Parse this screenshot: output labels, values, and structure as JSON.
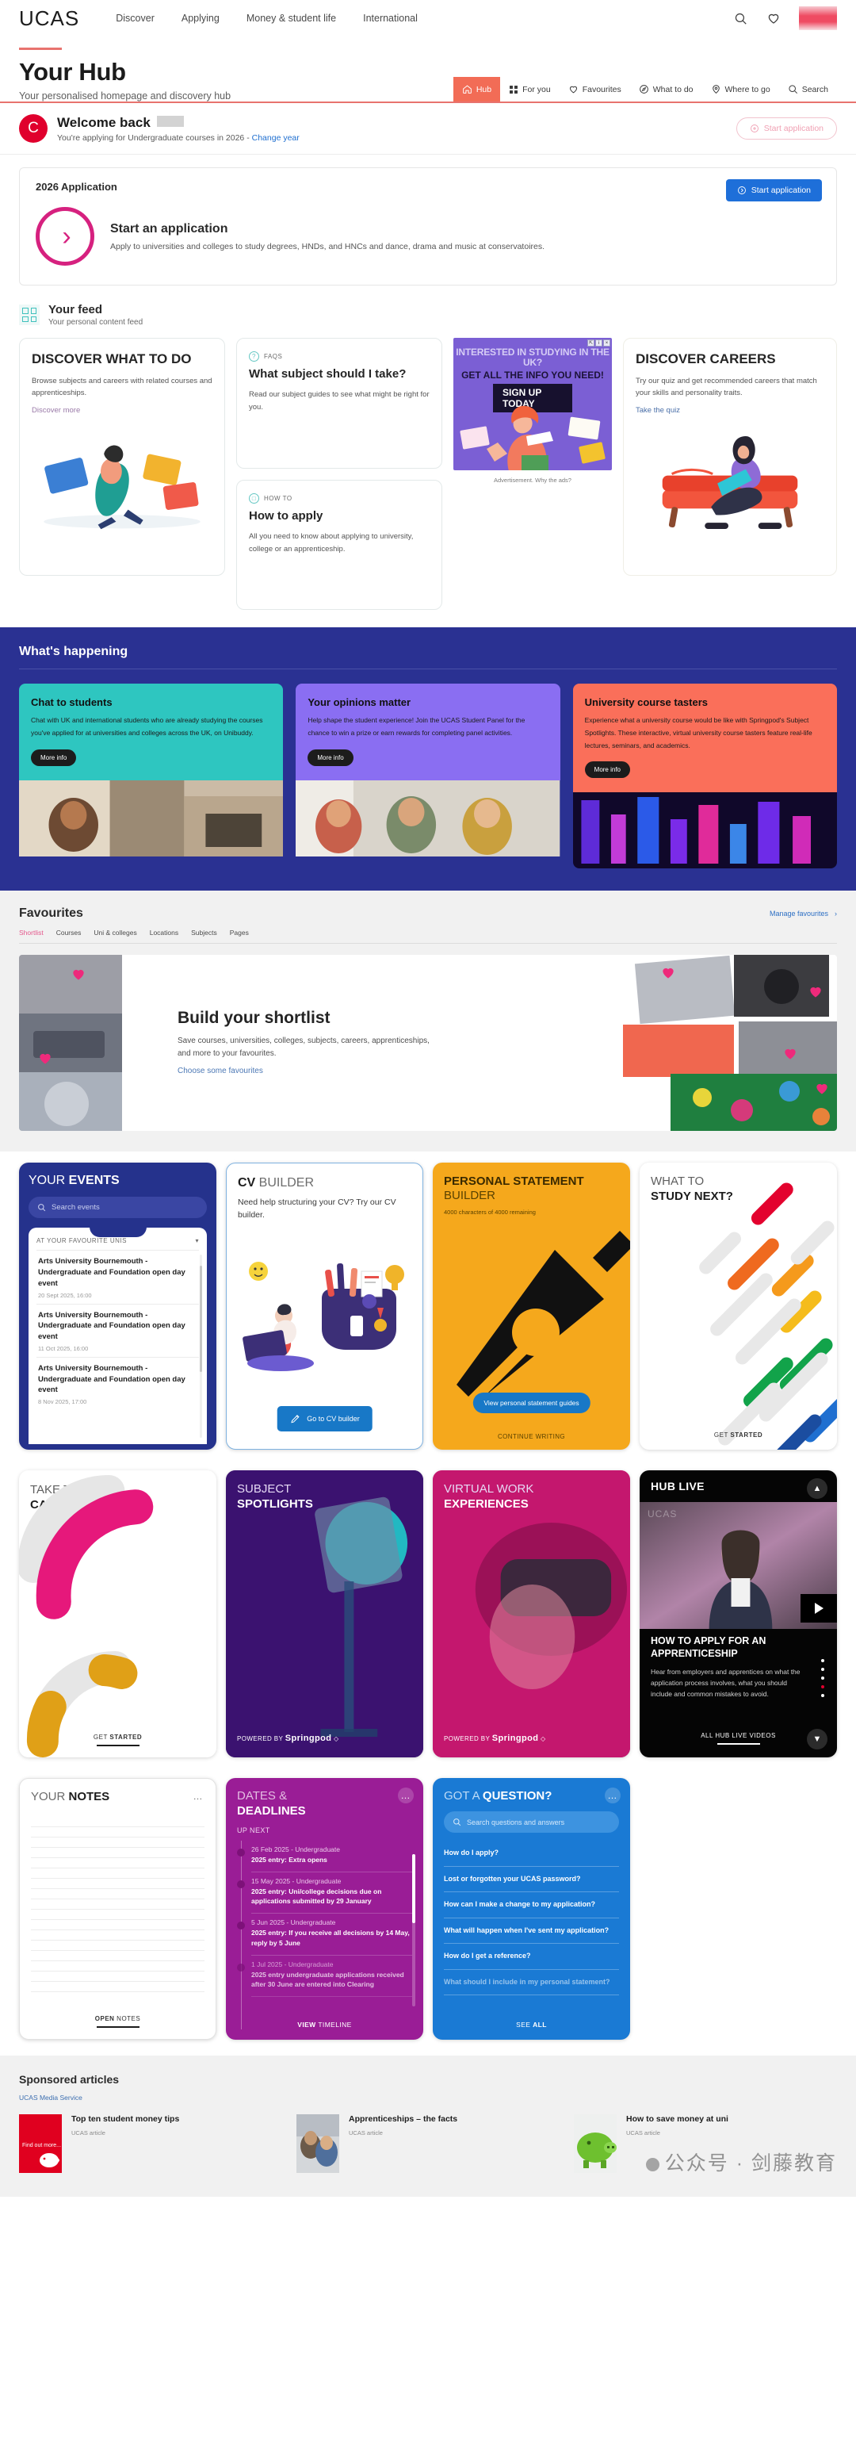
{
  "topnav": {
    "logo": "UCAS",
    "links": [
      "Discover",
      "Applying",
      "Money & student life",
      "International"
    ],
    "icons": {
      "search": "search-icon",
      "favourites": "heart-icon"
    }
  },
  "hero": {
    "title": "Your Hub",
    "subtitle": "Your personalised homepage and discovery hub",
    "tabs": [
      {
        "label": "Hub",
        "icon": "home-icon",
        "active": true
      },
      {
        "label": "For you",
        "icon": "grid-icon",
        "active": false
      },
      {
        "label": "Favourites",
        "icon": "heart-icon",
        "active": false
      },
      {
        "label": "What to do",
        "icon": "compass-icon",
        "active": false
      },
      {
        "label": "Where to go",
        "icon": "pin-icon",
        "active": false
      },
      {
        "label": "Search",
        "icon": "search-icon",
        "active": false
      }
    ]
  },
  "welcome": {
    "avatar_initial": "C",
    "greeting": "Welcome back",
    "name_redacted": true,
    "status_prefix": "You're applying for Undergraduate courses in 2026 -",
    "change_year_link": "Change year",
    "start_application_label": "Start application"
  },
  "application": {
    "card_title": "2026 Application",
    "start_button": "Start application",
    "heading": "Start an application",
    "description": "Apply to universities and colleges to study degrees, HNDs, and HNCs and dance, drama and music at conservatoires."
  },
  "feed": {
    "heading": "Your feed",
    "subheading": "Your personal content feed",
    "cards": [
      {
        "title": "DISCOVER WHAT TO DO",
        "body": "Browse subjects and careers with related courses and apprenticeships.",
        "link": "Discover more"
      },
      {
        "eyebrow": "FAQS",
        "title": "What subject should I take?",
        "body": "Read our subject guides to see what might be right for you."
      },
      {
        "eyebrow": "HOW TO",
        "title": "How to apply",
        "body": "All you need to know about applying to university, college or an apprenticeship."
      },
      {
        "title": "DISCOVER CAREERS",
        "body": "Try our quiz and get recommended careers that match your skills and personality traits.",
        "link": "Take the quiz"
      }
    ],
    "ad": {
      "line1": "INTERESTED IN STUDYING IN THE UK?",
      "line2": "GET ALL THE INFO YOU NEED!",
      "cta": "SIGN UP TODAY",
      "note": "Advertisement.",
      "note_link": "Why the ads?"
    }
  },
  "happening": {
    "heading": "What's happening",
    "cards": [
      {
        "title": "Chat to students",
        "body": "Chat with UK and international students who are already studying the courses you've applied for at universities and colleges across the UK, on Unibuddy.",
        "button": "More info",
        "color": "#2ec6c0"
      },
      {
        "title": "Your opinions matter",
        "body": "Help shape the student experience! Join the UCAS Student Panel for the chance to win a prize or earn rewards for completing panel activities.",
        "button": "More info",
        "color": "#8a6ef2"
      },
      {
        "title": "University course tasters",
        "body": "Experience what a university course would be like with Springpod's Subject Spotlights. These interactive, virtual university course tasters feature real-life lectures, seminars, and academics.",
        "button": "More info",
        "color": "#fa6f5a"
      }
    ]
  },
  "favourites": {
    "heading": "Favourites",
    "manage_link": "Manage favourites",
    "tabs": [
      "Shortlist",
      "Courses",
      "Uni & colleges",
      "Locations",
      "Subjects",
      "Pages"
    ],
    "active_tab": "Shortlist",
    "shortlist": {
      "title": "Build your shortlist",
      "body": "Save courses, universities, colleges, subjects, careers, apprenticeships, and more to your favourites.",
      "link": "Choose some favourites"
    }
  },
  "tiles": {
    "events": {
      "title_light": "YOUR ",
      "title_bold": "EVENTS",
      "search_placeholder": "Search events",
      "list_header": "AT YOUR FAVOURITE UNIS",
      "items": [
        {
          "name": "Arts University Bournemouth - Undergraduate and Foundation open day event",
          "date": "20 Sept 2025, 16:00"
        },
        {
          "name": "Arts University Bournemouth - Undergraduate and Foundation open day event",
          "date": "11 Oct 2025, 16:00"
        },
        {
          "name": "Arts University Bournemouth - Undergraduate and Foundation open day event",
          "date": "8 Nov 2025, 17:00"
        }
      ]
    },
    "cv": {
      "title_bold": "CV ",
      "title_light": "BUILDER",
      "body": "Need help structuring your CV? Try our CV builder.",
      "button": "Go to CV builder"
    },
    "personal_statement": {
      "title_bold": "PERSONAL STATEMENT ",
      "title_light": "BUILDER",
      "counter": "4000 characters of 4000 remaining",
      "button": "View personal statement guides",
      "footer": "CONTINUE WRITING"
    },
    "study_next": {
      "title_light": "WHAT TO",
      "title_bold": "STUDY NEXT?",
      "footer_light": "GET ",
      "footer_bold": "STARTED"
    },
    "careers_quiz": {
      "title_light": "TAKE THE",
      "title_bold": "CAREERS QUIZ",
      "footer_light": "GET ",
      "footer_bold": "STARTED"
    },
    "spotlights": {
      "title_light": "SUBJECT",
      "title_bold": "SPOTLIGHTS",
      "powered_by": "POWERED BY ",
      "brand": "Springpod"
    },
    "virtual_work": {
      "title_light": "VIRTUAL WORK",
      "title_bold": "EXPERIENCES",
      "powered_by": "POWERED BY ",
      "brand": "Springpod"
    },
    "hub_live": {
      "title": "HUB LIVE",
      "watermark": "UCAS",
      "video_title": "HOW TO APPLY FOR AN APPRENTICESHIP",
      "video_body": "Hear from employers and apprentices on what the application process involves, what you should include and common mistakes to avoid.",
      "footer": "ALL HUB LIVE VIDEOS",
      "dot_count": 5,
      "active_dot": 4
    },
    "notes": {
      "title_light": "YOUR ",
      "title_bold": "NOTES",
      "footer_bold": "OPEN ",
      "footer_light": "NOTES",
      "menu": "…"
    },
    "dates": {
      "title_light": "DATES &",
      "title_bold": "DEADLINES",
      "up_next": "UP NEXT",
      "items": [
        {
          "date": "26 Feb 2025 - Undergraduate",
          "text": "2025 entry: Extra opens"
        },
        {
          "date": "15 May 2025 - Undergraduate",
          "text": "2025 entry: Uni/college decisions due on applications submitted by 29 January"
        },
        {
          "date": "5 Jun 2025 - Undergraduate",
          "text": "2025 entry: If you receive all decisions by 14 May, reply by 5 June"
        },
        {
          "date": "1 Jul 2025 - Undergraduate",
          "text": "2025 entry undergraduate applications received after 30 June are entered into Clearing"
        }
      ],
      "footer_bold": "VIEW ",
      "footer_light": "TIMELINE",
      "menu": "…"
    },
    "question": {
      "title_light": "GOT A ",
      "title_bold": "QUESTION?",
      "search_placeholder": "Search questions and answers",
      "items": [
        "How do I apply?",
        "Lost or forgotten your UCAS password?",
        "How can I make a change to my application?",
        "What will happen when I've sent my application?",
        "How do I get a reference?",
        "What should I include in my personal statement?"
      ],
      "footer_light": "SEE ",
      "footer_bold": "ALL",
      "menu": "…"
    }
  },
  "sponsored": {
    "heading": "Sponsored articles",
    "provider": "UCAS Media Service",
    "articles": [
      {
        "title": "Top ten student money tips",
        "meta": "UCAS article",
        "thumb_text": "Find out more..."
      },
      {
        "title": "Apprenticeships – the facts",
        "meta": "UCAS article"
      },
      {
        "title": "How to save money at uni",
        "meta": "UCAS article"
      }
    ]
  },
  "watermark": "公众号 · 剑藤教育"
}
